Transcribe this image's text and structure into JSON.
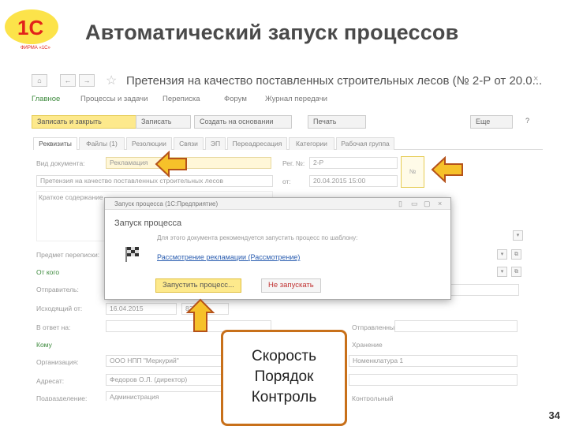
{
  "slide": {
    "title": "Автоматический запуск процессов",
    "page_number": "34",
    "logo_text": "1С",
    "logo_sub": "ФИРМА «1С»"
  },
  "window": {
    "title": "Претензия на качество поставленных строительных лесов (№ 2-Р от 20.0...",
    "close": "×",
    "nav": {
      "home": "⌂",
      "back": "←",
      "forward": "→"
    }
  },
  "menu": [
    "Главное",
    "Процессы и задачи",
    "Переписка",
    "Форум",
    "Журнал передачи"
  ],
  "toolbar": {
    "save_close": "Записать и закрыть",
    "save": "Записать",
    "create_based": "Создать на основании",
    "print": "Печать",
    "more": "Еще",
    "help": "?"
  },
  "tabs": [
    "Реквизиты",
    "Файлы (1)",
    "Резолюции",
    "Связи",
    "ЭП",
    "Переадресация",
    "Категории",
    "Рабочая группа"
  ],
  "form": {
    "doc_type_label": "Вид документа:",
    "doc_type_value": "Рекламация",
    "reg_label": "Рег. №:",
    "reg_value": "2-Р",
    "stamp": "№",
    "subject": "Претензия на качество поставленных строительных лесов",
    "from_label": "от:",
    "date_value": "20.04.2015 15:00",
    "summary_placeholder": "Краткое содержание",
    "correspondence_label": "Предмет переписки:",
    "from_whom": "От кого",
    "sender_label": "Отправитель:",
    "outgoing_label": "Исходящий от:",
    "outgoing_date": "16.04.2015",
    "outgoing_no": "82",
    "reply_label": "В ответ на:",
    "sent_label": "Отправленный:",
    "to_whom": "Кому",
    "org_label": "Организация:",
    "org_value": "ООО НПП \"Меркурий\"",
    "storage_label": "Хранение",
    "addressee_label": "Адресат:",
    "addressee_value": "Федоров О.Л. (директор)",
    "dept_label": "Подразделение:",
    "dept_value": "Администрация",
    "nomenclature_value": "Номенклатура 1",
    "copy_label": "Контрольный"
  },
  "dialog": {
    "caption": "Запуск процесса (1С:Предприятие)",
    "title": "Запуск процесса",
    "body": "Для этого документа рекомендуется запустить процесс по шаблону:",
    "link": "Рассмотрение рекламации (Рассмотрение)",
    "start_button": "Запустить процесс...",
    "skip_button": "Не запускать",
    "controls": [
      "▯",
      "▭",
      "▢",
      "×"
    ]
  },
  "callout": [
    "Скорость",
    "Порядок",
    "Контроль"
  ],
  "colors": {
    "arrow_fill": "#f6c12a",
    "arrow_stroke": "#b5521a",
    "callout_border": "#c8701a",
    "primary_button": "#fde98c",
    "logo_red": "#e2231a",
    "logo_yellow": "#fce34a"
  }
}
